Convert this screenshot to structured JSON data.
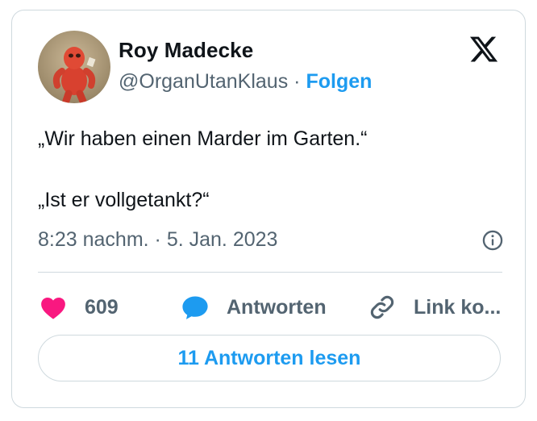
{
  "author": {
    "name": "Roy Madecke",
    "handle": "@OrganUtanKlaus",
    "separator": "·",
    "follow_label": "Folgen"
  },
  "tweet": {
    "text": "„Wir haben einen Marder im Garten.“\n\n„Ist er vollgetankt?“",
    "time": "8:23 nachm.",
    "meta_separator": "·",
    "date": "5. Jan. 2023"
  },
  "actions": {
    "likes": "609",
    "reply_label": "Antworten",
    "copy_link_label": "Link ko..."
  },
  "read_replies_label": "11 Antworten lesen",
  "colors": {
    "accent": "#1d9bf0",
    "like": "#f91880",
    "text": "#0f1419",
    "muted": "#536471",
    "border": "#cfd9de"
  },
  "icons": [
    "x-logo-icon",
    "info-icon",
    "heart-icon",
    "reply-bubble-icon",
    "link-icon"
  ]
}
